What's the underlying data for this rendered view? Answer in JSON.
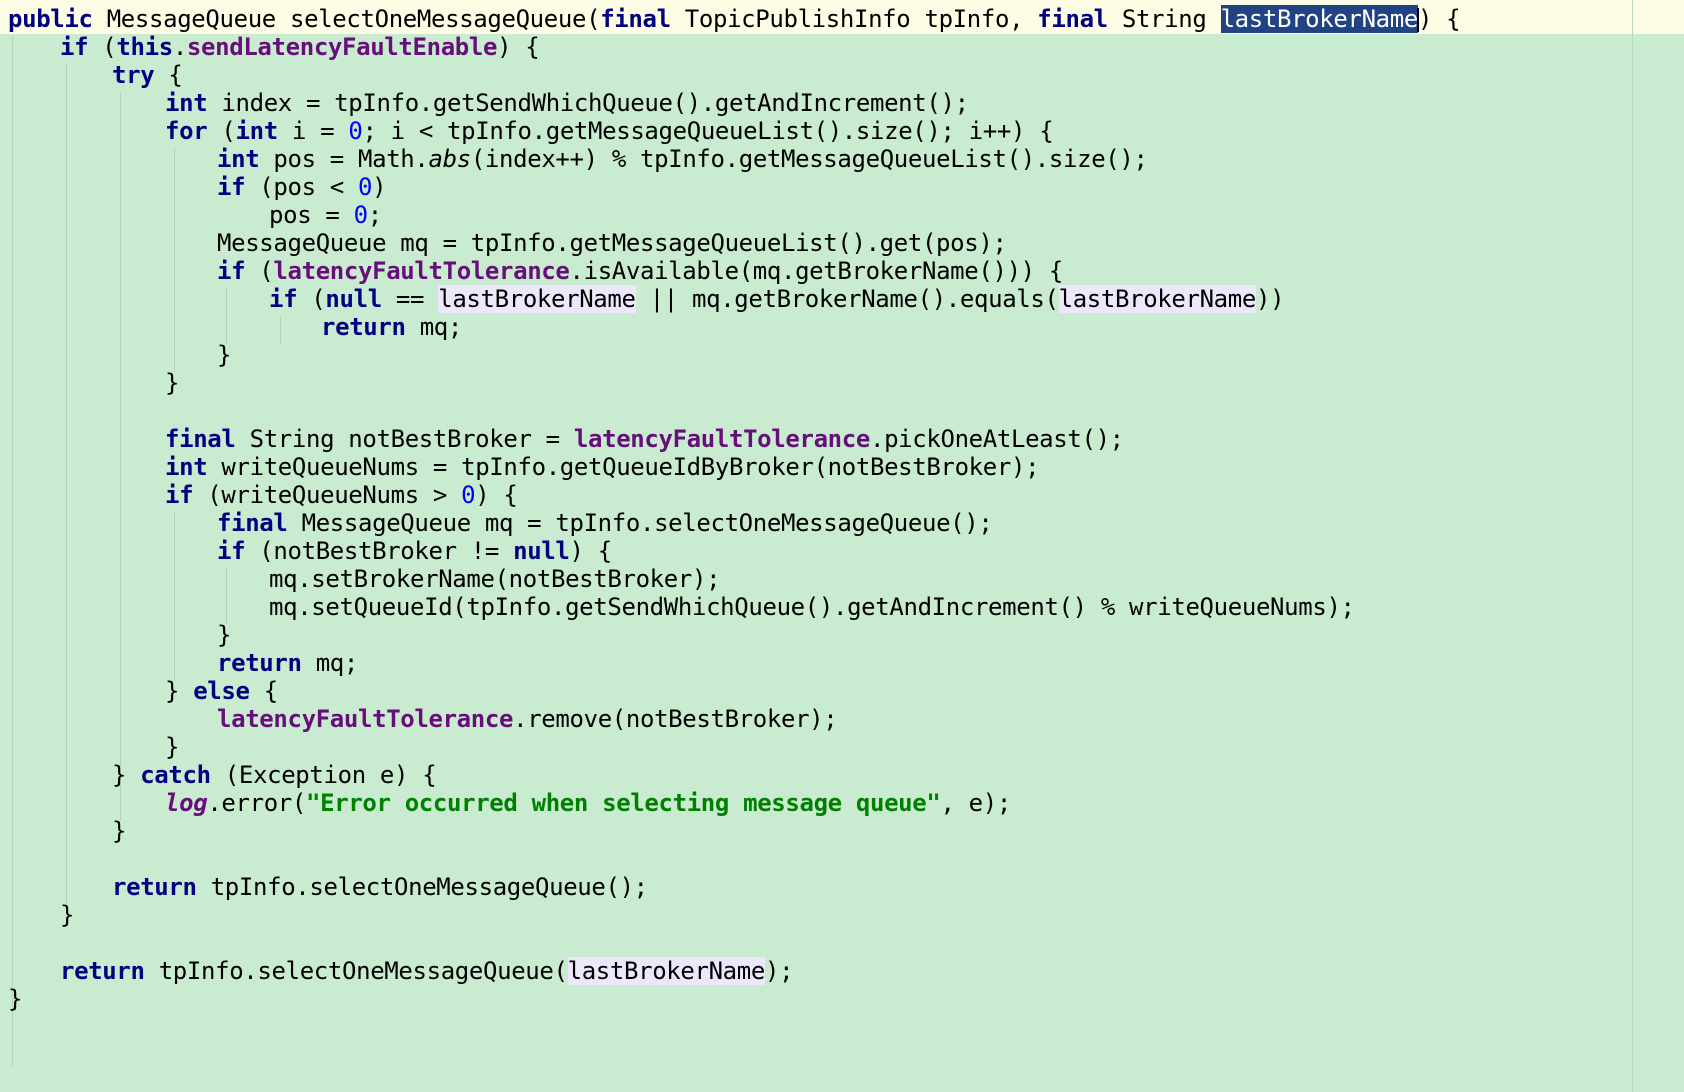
{
  "code": {
    "l01": [
      "public",
      " MessageQueue selectOneMessageQueue(",
      "final",
      " TopicPublishInfo tpInfo, ",
      "final",
      " String ",
      "lastBrokerName",
      ") {"
    ],
    "l02": [
      "if",
      " (",
      "this",
      ".",
      "sendLatencyFaultEnable",
      ") {"
    ],
    "l03": [
      "try",
      " {"
    ],
    "l04": [
      "int",
      " index = tpInfo.getSendWhichQueue().getAndIncrement();"
    ],
    "l05": [
      "for",
      " (",
      "int",
      " i = ",
      "0",
      "; i < tpInfo.getMessageQueueList().size(); i++) {"
    ],
    "l06": [
      "int",
      " pos = Math.",
      "abs",
      "(index++) % tpInfo.getMessageQueueList().size();"
    ],
    "l07": [
      "if",
      " (pos < ",
      "0",
      ")"
    ],
    "l08": [
      "pos = ",
      "0",
      ";"
    ],
    "l09": [
      "MessageQueue mq = tpInfo.getMessageQueueList().get(pos);"
    ],
    "l10": [
      "if",
      " (",
      "latencyFaultTolerance",
      ".isAvailable(mq.getBrokerName())) {"
    ],
    "l11": [
      "if",
      " (",
      "null",
      " == ",
      "lastBrokerName",
      " || mq.getBrokerName().equals(",
      "lastBrokerName",
      "))"
    ],
    "l12": [
      "return",
      " mq;"
    ],
    "l13": [
      "}"
    ],
    "l14": [
      "}"
    ],
    "l15": [
      "final",
      " String notBestBroker = ",
      "latencyFaultTolerance",
      ".pickOneAtLeast();"
    ],
    "l16": [
      "int",
      " writeQueueNums = tpInfo.getQueueIdByBroker(notBestBroker);"
    ],
    "l17": [
      "if",
      " (writeQueueNums > ",
      "0",
      ") {"
    ],
    "l18": [
      "final",
      " MessageQueue mq = tpInfo.selectOneMessageQueue();"
    ],
    "l19": [
      "if",
      " (notBestBroker != ",
      "null",
      ") {"
    ],
    "l20": [
      "mq.setBrokerName(notBestBroker);"
    ],
    "l21": [
      "mq.setQueueId(tpInfo.getSendWhichQueue().getAndIncrement() % writeQueueNums);"
    ],
    "l22": [
      "}"
    ],
    "l23": [
      "return",
      " mq;"
    ],
    "l24": [
      "} ",
      "else",
      " {"
    ],
    "l25": [
      "latencyFaultTolerance",
      ".remove(notBestBroker);"
    ],
    "l26": [
      "}"
    ],
    "l27": [
      "} ",
      "catch",
      " (Exception e) {"
    ],
    "l28": [
      "log",
      ".error(",
      "\"Error occurred when selecting message queue\"",
      ", e);"
    ],
    "l29": [
      "}"
    ],
    "l30": [
      "return",
      " tpInfo.selectOneMessageQueue();"
    ],
    "l31": [
      "}"
    ],
    "l32": [
      "return",
      " tpInfo.selectOneMessageQueue(",
      "lastBrokerName",
      ");"
    ],
    "l33": [
      "}"
    ]
  },
  "colors": {
    "editor_background": "#c9ebcf",
    "current_line_background": "#fdfce4",
    "keyword": "#000080",
    "field": "#660e7a",
    "number": "#0000ff",
    "string": "#008000",
    "usage_highlight": "#ede7fb",
    "selection": "#214283"
  }
}
